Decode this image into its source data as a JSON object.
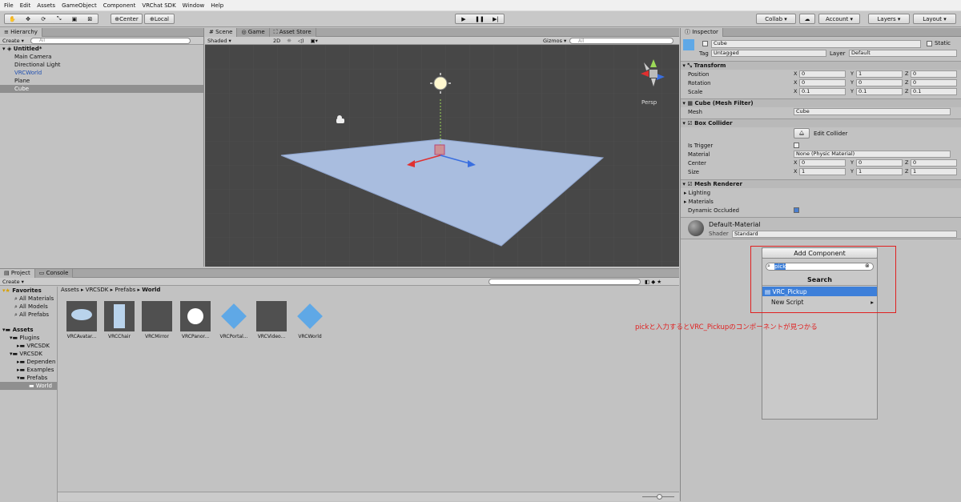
{
  "menu": [
    "File",
    "Edit",
    "Assets",
    "GameObject",
    "Component",
    "VRChat SDK",
    "Window",
    "Help"
  ],
  "toolbar": {
    "center": "Center",
    "local": "Local",
    "collab": "Collab",
    "account": "Account",
    "layers": "Layers",
    "layout": "Layout"
  },
  "hierarchy": {
    "tab": "Hierarchy",
    "create": "Create",
    "search_placeholder": "All",
    "scene": "Untitled*",
    "items": [
      "Main Camera",
      "Directional Light",
      "VRCWorld",
      "Plane",
      "Cube"
    ]
  },
  "scene": {
    "tabs": [
      "Scene",
      "Game",
      "Asset Store"
    ],
    "shading": "Shaded",
    "mode2d": "2D",
    "gizmos": "Gizmos",
    "search_placeholder": "All",
    "persp": "Persp"
  },
  "project": {
    "tabs": [
      "Project",
      "Console"
    ],
    "create": "Create",
    "favorites": "Favorites",
    "fav_items": [
      "All Materials",
      "All Models",
      "All Prefabs"
    ],
    "assets": "Assets",
    "tree": [
      "Plugins",
      "VRCSDK",
      "VRCSDK",
      "Dependen",
      "Examples",
      "Prefabs",
      "World"
    ],
    "breadcrumb": [
      "Assets",
      "VRCSDK",
      "Prefabs",
      "World"
    ],
    "items": [
      "VRCAvatar...",
      "VRCChair",
      "VRCMirror",
      "VRCPanor...",
      "VRCPortal...",
      "VRCVideo...",
      "VRCWorld"
    ]
  },
  "inspector": {
    "tab": "Inspector",
    "name": "Cube",
    "static": "Static",
    "tag_label": "Tag",
    "tag": "Untagged",
    "layer_label": "Layer",
    "layer": "Default",
    "transform": {
      "title": "Transform",
      "rows": [
        {
          "label": "Position",
          "x": "0",
          "y": "1",
          "z": "0"
        },
        {
          "label": "Rotation",
          "x": "0",
          "y": "0",
          "z": "0"
        },
        {
          "label": "Scale",
          "x": "0.1",
          "y": "0.1",
          "z": "0.1"
        }
      ]
    },
    "meshfilter": {
      "title": "Cube (Mesh Filter)",
      "mesh_label": "Mesh",
      "mesh": "Cube"
    },
    "boxcollider": {
      "title": "Box Collider",
      "edit": "Edit Collider",
      "trigger": "Is Trigger",
      "material_label": "Material",
      "material": "None (Physic Material)",
      "center": {
        "label": "Center",
        "x": "0",
        "y": "0",
        "z": "0"
      },
      "size": {
        "label": "Size",
        "x": "1",
        "y": "1",
        "z": "1"
      }
    },
    "meshrenderer": {
      "title": "Mesh Renderer",
      "lighting": "Lighting",
      "materials": "Materials",
      "occluded": "Dynamic Occluded"
    },
    "material": {
      "name": "Default-Material",
      "shader_label": "Shader",
      "shader": "Standard"
    },
    "addcomp": {
      "button": "Add Component",
      "search": "pick",
      "header": "Search",
      "results": [
        "VRC_Pickup",
        "New Script"
      ]
    }
  },
  "annotation": "pickと入力するとVRC_Pickupのコンポーネントが見つかる",
  "colors": {
    "annotation": "#e02020",
    "selection": "#3d7fd9",
    "plane": "#a9bddf",
    "sceneBg": "#474747"
  }
}
